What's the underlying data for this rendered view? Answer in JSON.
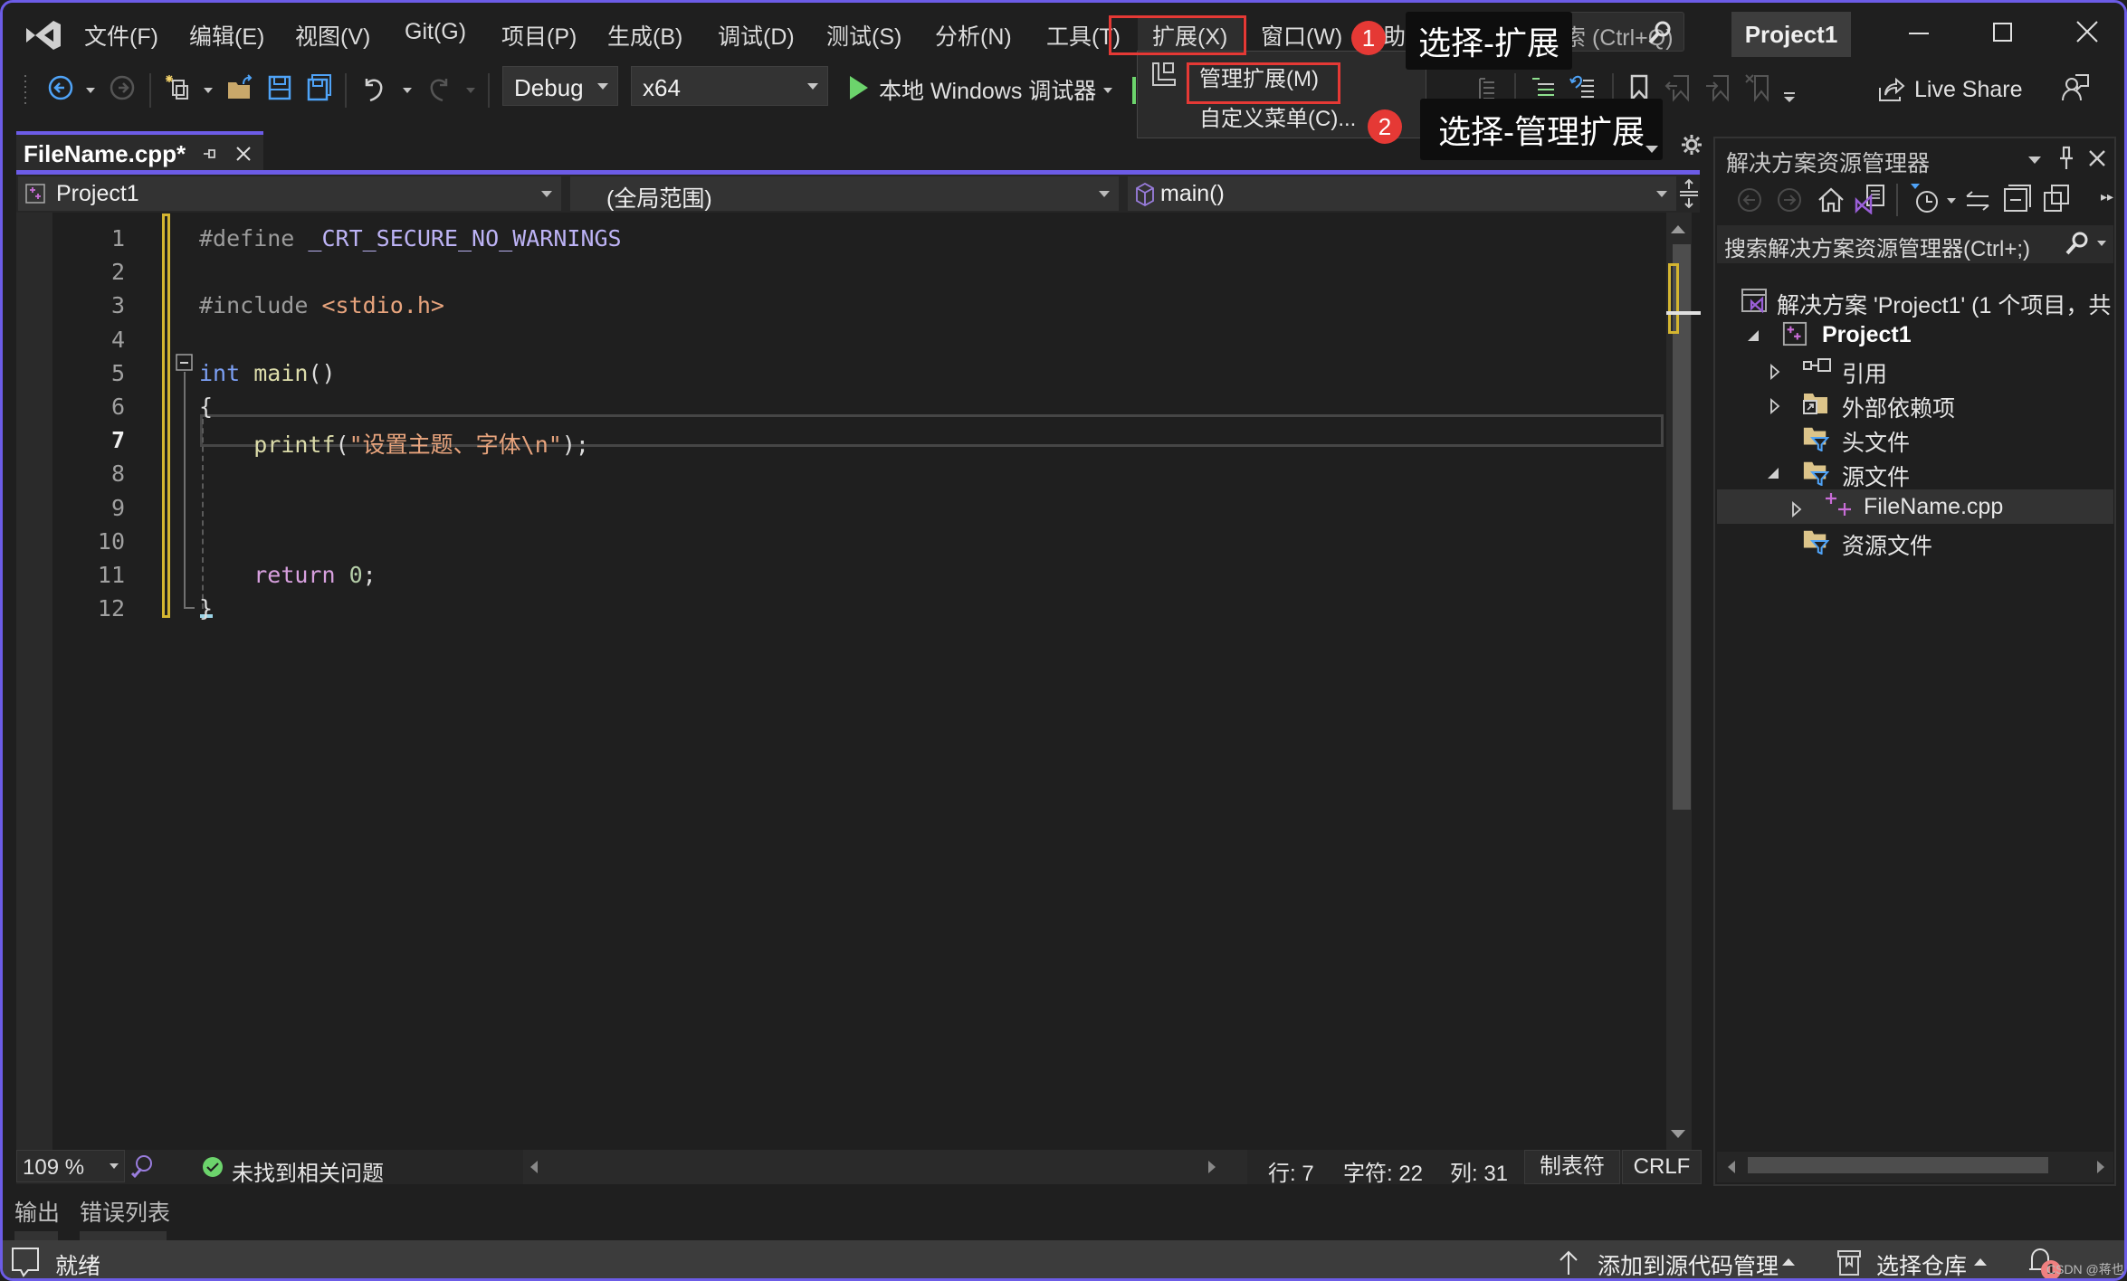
{
  "menubar": {
    "items": [
      "文件(F)",
      "编辑(E)",
      "视图(V)",
      "Git(G)",
      "项目(P)",
      "生成(B)",
      "调试(D)",
      "测试(S)",
      "分析(N)",
      "工具(T)",
      "扩展(X)",
      "窗口(W)",
      "帮助(H)"
    ],
    "search_placeholder": "搜索 (Ctrl+Q)",
    "project_name": "Project1"
  },
  "toolbar": {
    "configuration": "Debug",
    "platform": "x64",
    "run_label": "本地 Windows 调试器",
    "live_share": "Live Share"
  },
  "extensions_menu": {
    "items": [
      {
        "label": "管理扩展(M)",
        "icon": "extensions-icon"
      },
      {
        "label": "自定义菜单(C)..."
      }
    ]
  },
  "annotations": [
    {
      "number": "1",
      "text": "选择-扩展"
    },
    {
      "number": "2",
      "text": "选择-管理扩展"
    }
  ],
  "editor": {
    "tab_label": "FileName.cpp*",
    "nav_project": "Project1",
    "nav_scope": "(全局范围)",
    "nav_member": "main()",
    "current_line": 7,
    "lines": [
      {
        "n": "1",
        "tokens": [
          {
            "t": "#define ",
            "c": "c-pp"
          },
          {
            "t": "_CRT_SECURE_NO_WARNINGS",
            "c": "c-macro"
          }
        ]
      },
      {
        "n": "2",
        "tokens": []
      },
      {
        "n": "3",
        "tokens": [
          {
            "t": "#include ",
            "c": "c-pp"
          },
          {
            "t": "<stdio.h>",
            "c": "c-str"
          }
        ]
      },
      {
        "n": "4",
        "tokens": []
      },
      {
        "n": "5",
        "tokens": [
          {
            "t": "int",
            "c": "c-kw"
          },
          {
            "t": " ",
            "c": "c-tx"
          },
          {
            "t": "main",
            "c": "c-fn"
          },
          {
            "t": "()",
            "c": "c-tx"
          }
        ]
      },
      {
        "n": "6",
        "tokens": [
          {
            "t": "{",
            "c": "c-tx"
          }
        ]
      },
      {
        "n": "7",
        "tokens": [
          {
            "t": "    ",
            "c": "c-tx"
          },
          {
            "t": "printf",
            "c": "c-fn"
          },
          {
            "t": "(",
            "c": "c-tx"
          },
          {
            "t": "\"设置主题、字体\\n\"",
            "c": "c-str"
          },
          {
            "t": ");",
            "c": "c-tx"
          }
        ]
      },
      {
        "n": "8",
        "tokens": []
      },
      {
        "n": "9",
        "tokens": []
      },
      {
        "n": "10",
        "tokens": []
      },
      {
        "n": "11",
        "tokens": [
          {
            "t": "    ",
            "c": "c-tx"
          },
          {
            "t": "return",
            "c": "c-ret"
          },
          {
            "t": " ",
            "c": "c-tx"
          },
          {
            "t": "0",
            "c": "c-num"
          },
          {
            "t": ";",
            "c": "c-tx"
          }
        ]
      },
      {
        "n": "12",
        "tokens": [
          {
            "t": "}",
            "c": "c-tx"
          }
        ]
      }
    ],
    "status": {
      "zoom": "109 %",
      "issues": "未找到相关问题",
      "line": "行: 7",
      "char": "字符: 22",
      "col": "列: 31",
      "indent": "制表符",
      "eol": "CRLF"
    }
  },
  "bottom_tabs": [
    "输出",
    "错误列表"
  ],
  "statusbar": {
    "ready": "就绪",
    "add_to_source_control": "添加到源代码管理",
    "select_repo": "选择仓库",
    "notifications": "1",
    "watermark": "CSDN @蒋也"
  },
  "solution_explorer": {
    "title": "解决方案资源管理器",
    "search_placeholder": "搜索解决方案资源管理器(Ctrl+;)",
    "tree": [
      {
        "label": "解决方案 'Project1' (1 个项目，共",
        "level": 0,
        "icon": "solution-icon",
        "expander": "none"
      },
      {
        "label": "Project1",
        "level": 1,
        "icon": "cpp-project-icon",
        "expander": "expanded",
        "bold": true
      },
      {
        "label": "引用",
        "level": 2,
        "icon": "references-icon",
        "expander": "collapsed"
      },
      {
        "label": "外部依赖项",
        "level": 2,
        "icon": "external-deps-icon",
        "expander": "collapsed"
      },
      {
        "label": "头文件",
        "level": 2,
        "icon": "filter-folder-icon",
        "expander": "none"
      },
      {
        "label": "源文件",
        "level": 2,
        "icon": "filter-folder-icon",
        "expander": "expanded"
      },
      {
        "label": "FileName.cpp",
        "level": 3,
        "icon": "cpp-file-icon",
        "expander": "collapsed",
        "selected": true
      },
      {
        "label": "资源文件",
        "level": 2,
        "icon": "filter-folder-icon",
        "expander": "none"
      }
    ]
  },
  "colors": {
    "accent": "#6c5ce7",
    "annotation_red": "#e53935",
    "run_green": "#6cd46c"
  }
}
